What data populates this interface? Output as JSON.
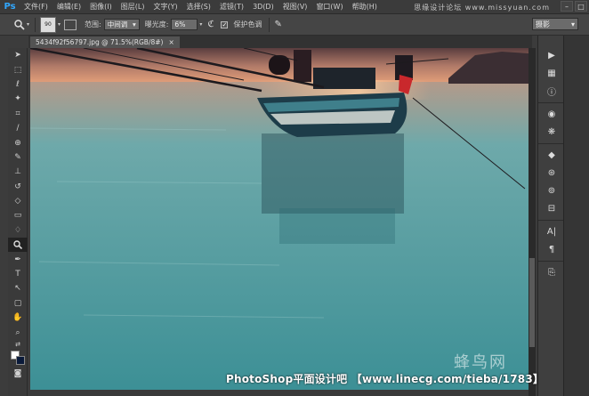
{
  "app": {
    "logo": "Ps"
  },
  "menu": [
    "文件(F)",
    "编辑(E)",
    "图像(I)",
    "图层(L)",
    "文字(Y)",
    "选择(S)",
    "滤镜(T)",
    "3D(D)",
    "视图(V)",
    "窗口(W)",
    "帮助(H)"
  ],
  "site_watermark": "思缘设计论坛  www.missyuan.com",
  "options": {
    "brush_size": "90",
    "range_label": "范围:",
    "range_value": "中间调",
    "exposure_label": "曝光度:",
    "exposure_value": "6%",
    "protect_tones_label": "保护色调",
    "protect_tones_checked": true,
    "workspace": "摄影"
  },
  "document": {
    "tab_title": "5434f92f56797.jpg @ 71.5%(RGB/8#)",
    "close_glyph": "×"
  },
  "tools": [
    "move-tool",
    "marquee-tool",
    "lasso-tool",
    "quick-select-tool",
    "crop-tool",
    "eyedropper-tool",
    "healing-brush-tool",
    "brush-tool",
    "clone-stamp-tool",
    "history-brush-tool",
    "eraser-tool",
    "gradient-tool",
    "blur-tool",
    "dodge-tool",
    "pen-tool",
    "type-tool",
    "path-select-tool",
    "shape-tool",
    "hand-tool",
    "zoom-tool"
  ],
  "active_tool_index": 13,
  "colors": {
    "foreground": "#ffffff",
    "background": "#0a1a3a",
    "accent": "#31a8ff"
  },
  "footer_banner": "PhotoShop平面设计吧 【www.linecg.com/tieba/1783】",
  "bird_watermark": "蜂鸟网"
}
